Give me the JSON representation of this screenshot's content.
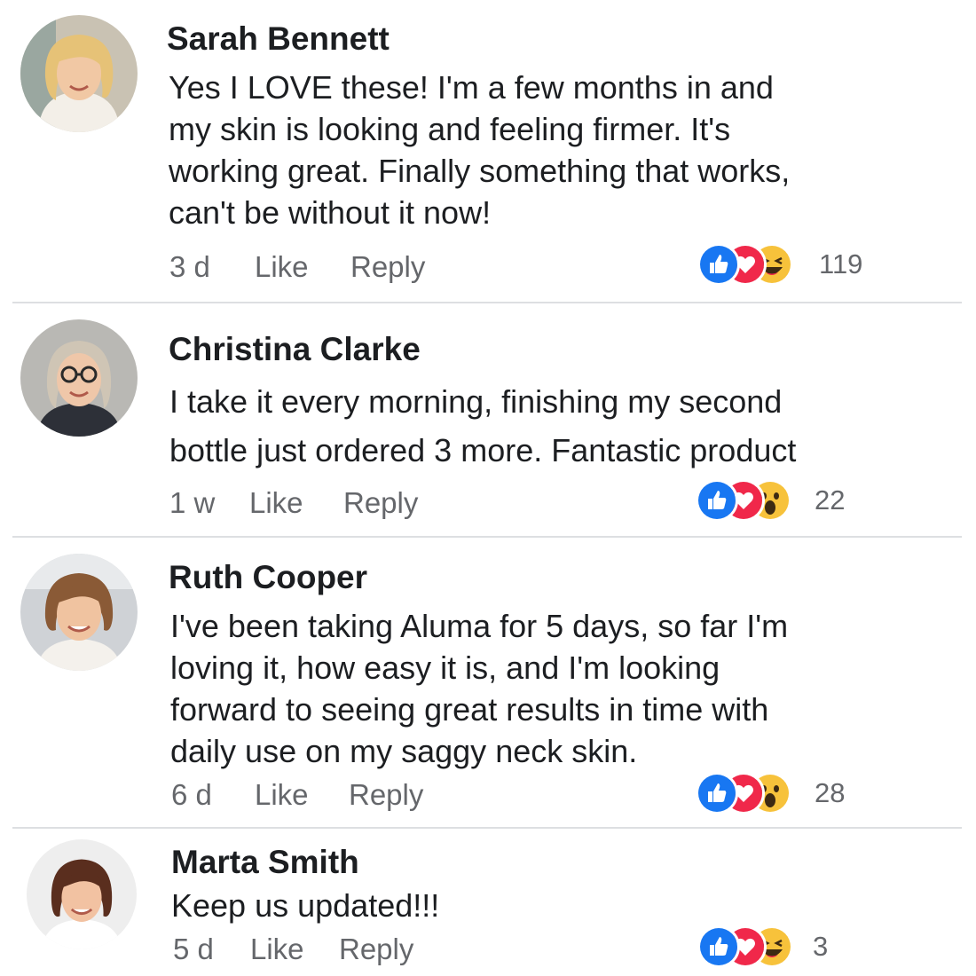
{
  "comments": [
    {
      "author": "Sarah Bennett",
      "lines": [
        "Yes I LOVE these! I'm a few months in and",
        "my skin is looking and feeling firmer. It's",
        "working great. Finally something that works,",
        "can't be without it now!"
      ],
      "time": "3 d",
      "like_label": "Like",
      "reply_label": "Reply",
      "reactions": [
        "like-icon",
        "love-icon",
        "haha-icon"
      ],
      "reaction_count": "119"
    },
    {
      "author": "Christina Clarke",
      "lines": [
        "I take it every morning, finishing my second",
        "bottle just ordered 3 more. Fantastic product"
      ],
      "time": "1 w",
      "like_label": "Like",
      "reply_label": "Reply",
      "reactions": [
        "like-icon",
        "love-icon",
        "wow-icon"
      ],
      "reaction_count": "22"
    },
    {
      "author": "Ruth Cooper",
      "lines": [
        "I've been taking Aluma for 5 days, so far I'm",
        "loving it, how easy it is, and I'm looking",
        "forward to seeing great results in time with",
        "daily use on my saggy neck skin."
      ],
      "time": "6 d",
      "like_label": "Like",
      "reply_label": "Reply",
      "reactions": [
        "like-icon",
        "love-icon",
        "wow-icon"
      ],
      "reaction_count": "28"
    },
    {
      "author": "Marta Smith",
      "lines": [
        "Keep us updated!!!"
      ],
      "time": "5 d",
      "like_label": "Like",
      "reply_label": "Reply",
      "reactions": [
        "like-icon",
        "love-icon",
        "haha-icon"
      ],
      "reaction_count": "3"
    }
  ],
  "colors": {
    "like": "#1877f2",
    "love": "#f0284a",
    "emoji": "#f7c23b",
    "meta_text": "#65676b",
    "divider": "#dddfe2"
  }
}
